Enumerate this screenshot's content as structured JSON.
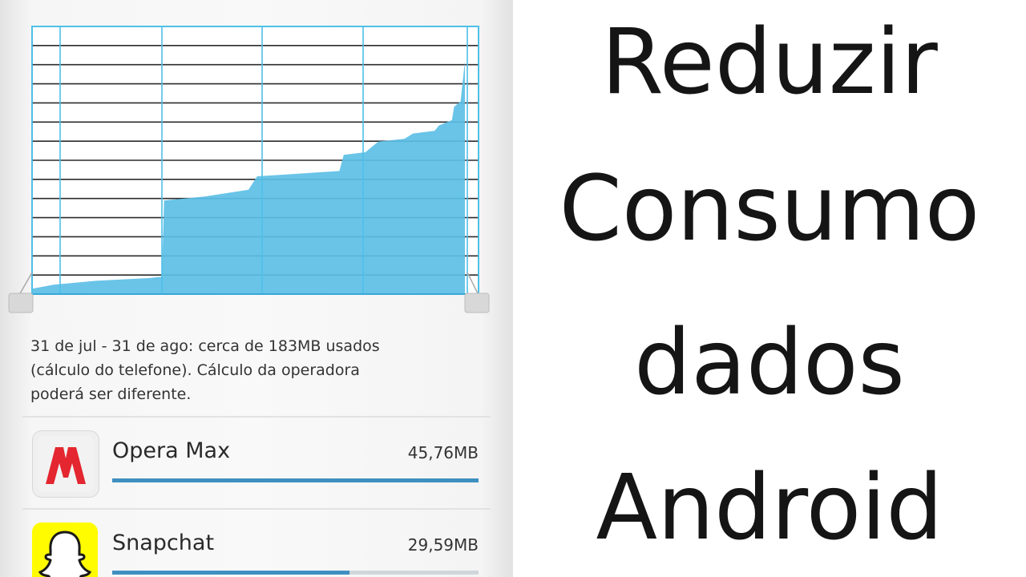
{
  "colors": {
    "chart_fill": "#5cbfe6",
    "chart_grid_vertical": "#4fc0e8",
    "chart_grid_horizontal": "#2c2c2c",
    "bar_fill": "#3f8fc0",
    "bar_track": "#cfd7da"
  },
  "chart_data": {
    "type": "area",
    "description_free": true,
    "series": [
      {
        "values": [
          [
            0,
            2
          ],
          [
            0.05,
            3.5
          ],
          [
            0.15,
            5
          ],
          [
            0.27,
            6
          ],
          [
            0.3,
            6.5
          ],
          [
            0.305,
            35
          ],
          [
            0.4,
            36.5
          ],
          [
            0.5,
            39
          ],
          [
            0.52,
            44
          ],
          [
            0.71,
            46
          ],
          [
            0.72,
            52
          ],
          [
            0.77,
            53
          ],
          [
            0.8,
            57
          ],
          [
            0.86,
            58
          ],
          [
            0.88,
            60
          ],
          [
            0.93,
            61
          ],
          [
            0.94,
            63
          ],
          [
            0.97,
            65
          ],
          [
            0.975,
            70
          ],
          [
            0.99,
            72
          ],
          [
            1.0,
            87
          ]
        ]
      }
    ],
    "ylim": [
      0,
      100
    ],
    "grid": true,
    "horizontal_gridlines": 13,
    "vertical_gridlines": 5
  },
  "summary_lines": [
    "31 de jul - 31 de ago: cerca de 183MB  usados",
    "(cálculo do telefone). Cálculo da operadora",
    "poderá ser diferente."
  ],
  "apps": [
    {
      "name": "Opera Max",
      "usage": "45,76MB",
      "share": 1.0,
      "icon": "opera-max-icon"
    },
    {
      "name": "Snapchat",
      "usage": "29,59MB",
      "share": 0.647,
      "icon": "snapchat-ghost-icon"
    }
  ],
  "headline": [
    "Reduzir",
    "Consumo",
    "dados",
    "Android"
  ]
}
